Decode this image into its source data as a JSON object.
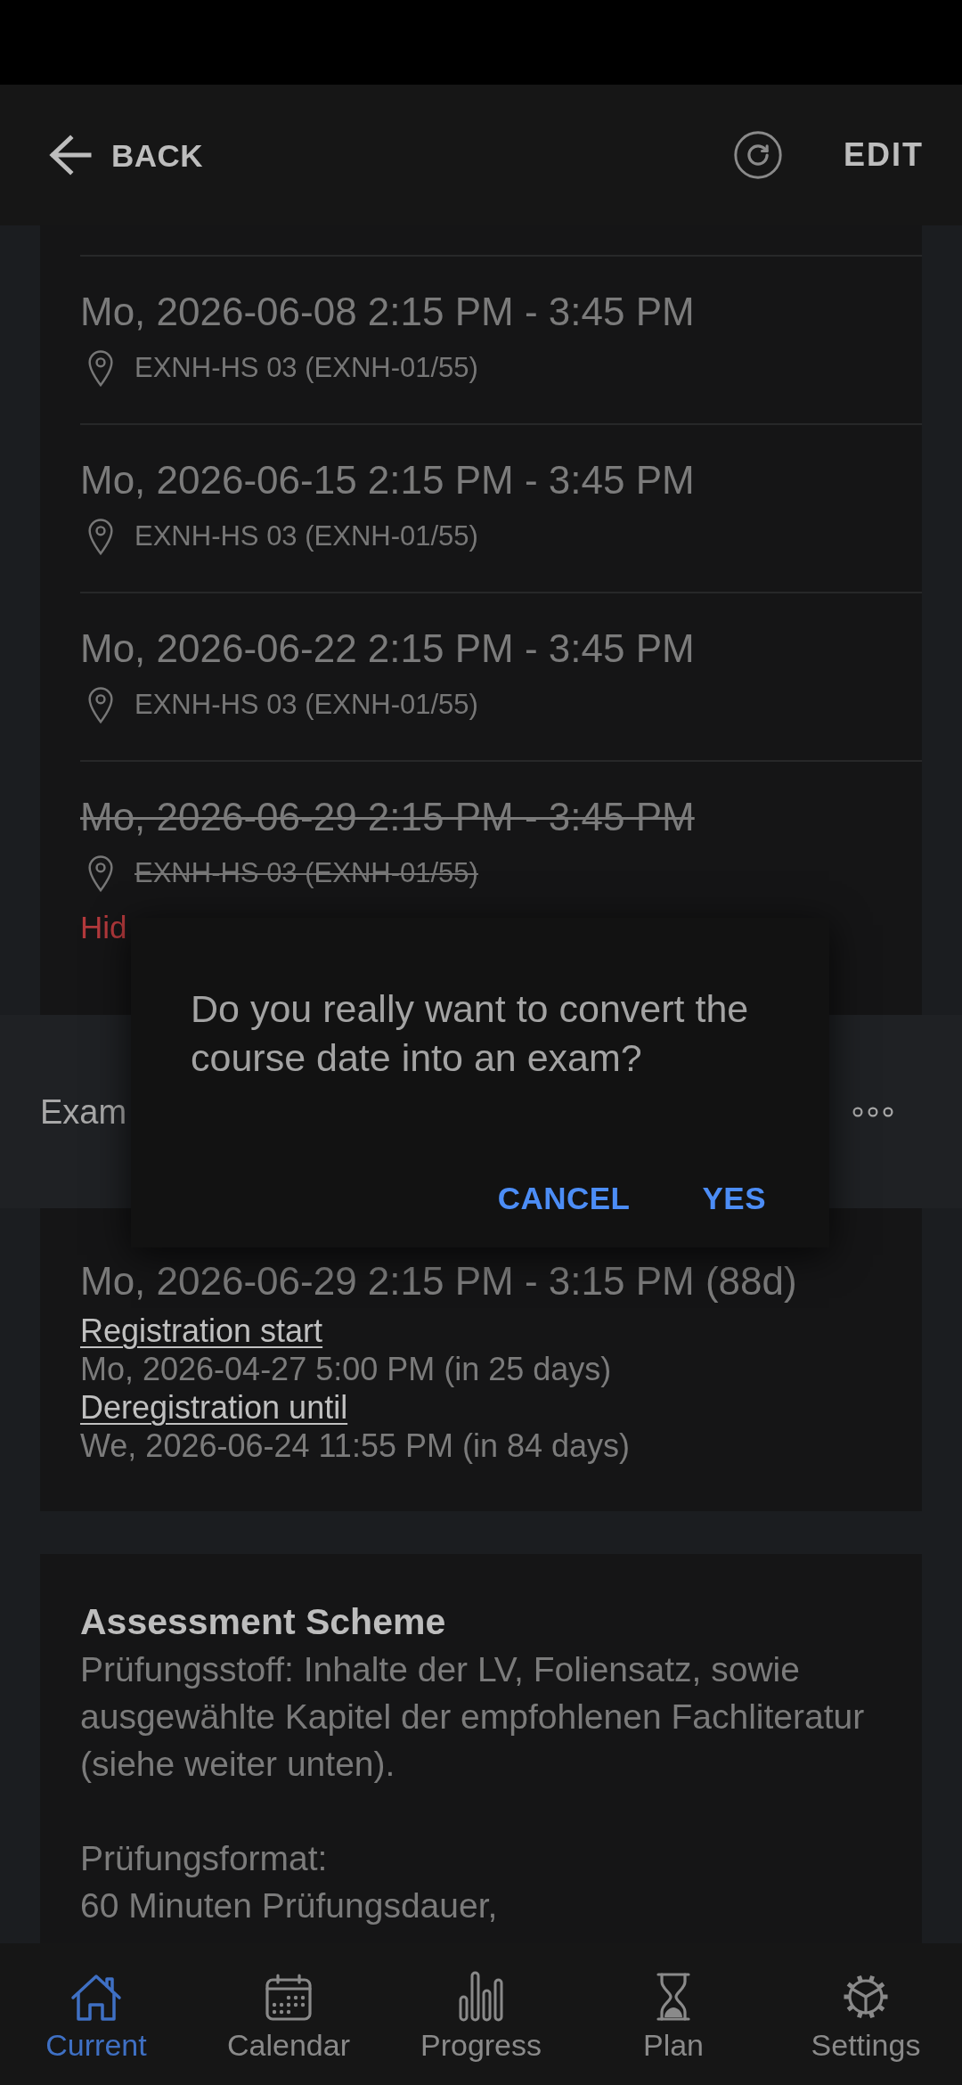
{
  "top_bar": {
    "back_label": "BACK",
    "edit_label": "EDIT"
  },
  "course_dates": [
    {
      "date": "Mo, 2026-06-08 2:15 PM - 3:45 PM",
      "location": "EXNH-HS 03 (EXNH-01/55)",
      "cancelled": false
    },
    {
      "date": "Mo, 2026-06-15 2:15 PM - 3:45 PM",
      "location": "EXNH-HS 03 (EXNH-01/55)",
      "cancelled": false
    },
    {
      "date": "Mo, 2026-06-22 2:15 PM - 3:45 PM",
      "location": "EXNH-HS 03 (EXNH-01/55)",
      "cancelled": false
    },
    {
      "date": "Mo, 2026-06-29 2:15 PM - 3:45 PM",
      "location": "EXNH-HS 03 (EXNH-01/55)",
      "cancelled": true,
      "note": "Hid"
    }
  ],
  "exam": {
    "title": "Exam",
    "date": "Mo, 2026-06-29 2:15 PM - 3:15 PM (88d)",
    "fields": [
      {
        "label": "Registration start",
        "value": "Mo, 2026-04-27 5:00 PM (in 25 days)"
      },
      {
        "label": "Deregistration until",
        "value": "We, 2026-06-24 11:55 PM (in 84 days)"
      }
    ]
  },
  "assessment": {
    "title": "Assessment Scheme",
    "text": "Prüfungsstoff: Inhalte der LV, Foliensatz, sowie ausgewählte Kapitel der empfohlenen Fachliteratur (siehe weiter unten).\n\nPrüfungsformat:\n60 Minuten Prüfungsdauer,"
  },
  "dialog": {
    "message": "Do you really want to convert the course date into an exam?",
    "buttons": [
      "CANCEL",
      "YES"
    ]
  },
  "bottom_nav": [
    {
      "label": "Current",
      "selected": true
    },
    {
      "label": "Calendar",
      "selected": false
    },
    {
      "label": "Progress",
      "selected": false
    },
    {
      "label": "Plan",
      "selected": false
    },
    {
      "label": "Settings",
      "selected": false
    }
  ]
}
